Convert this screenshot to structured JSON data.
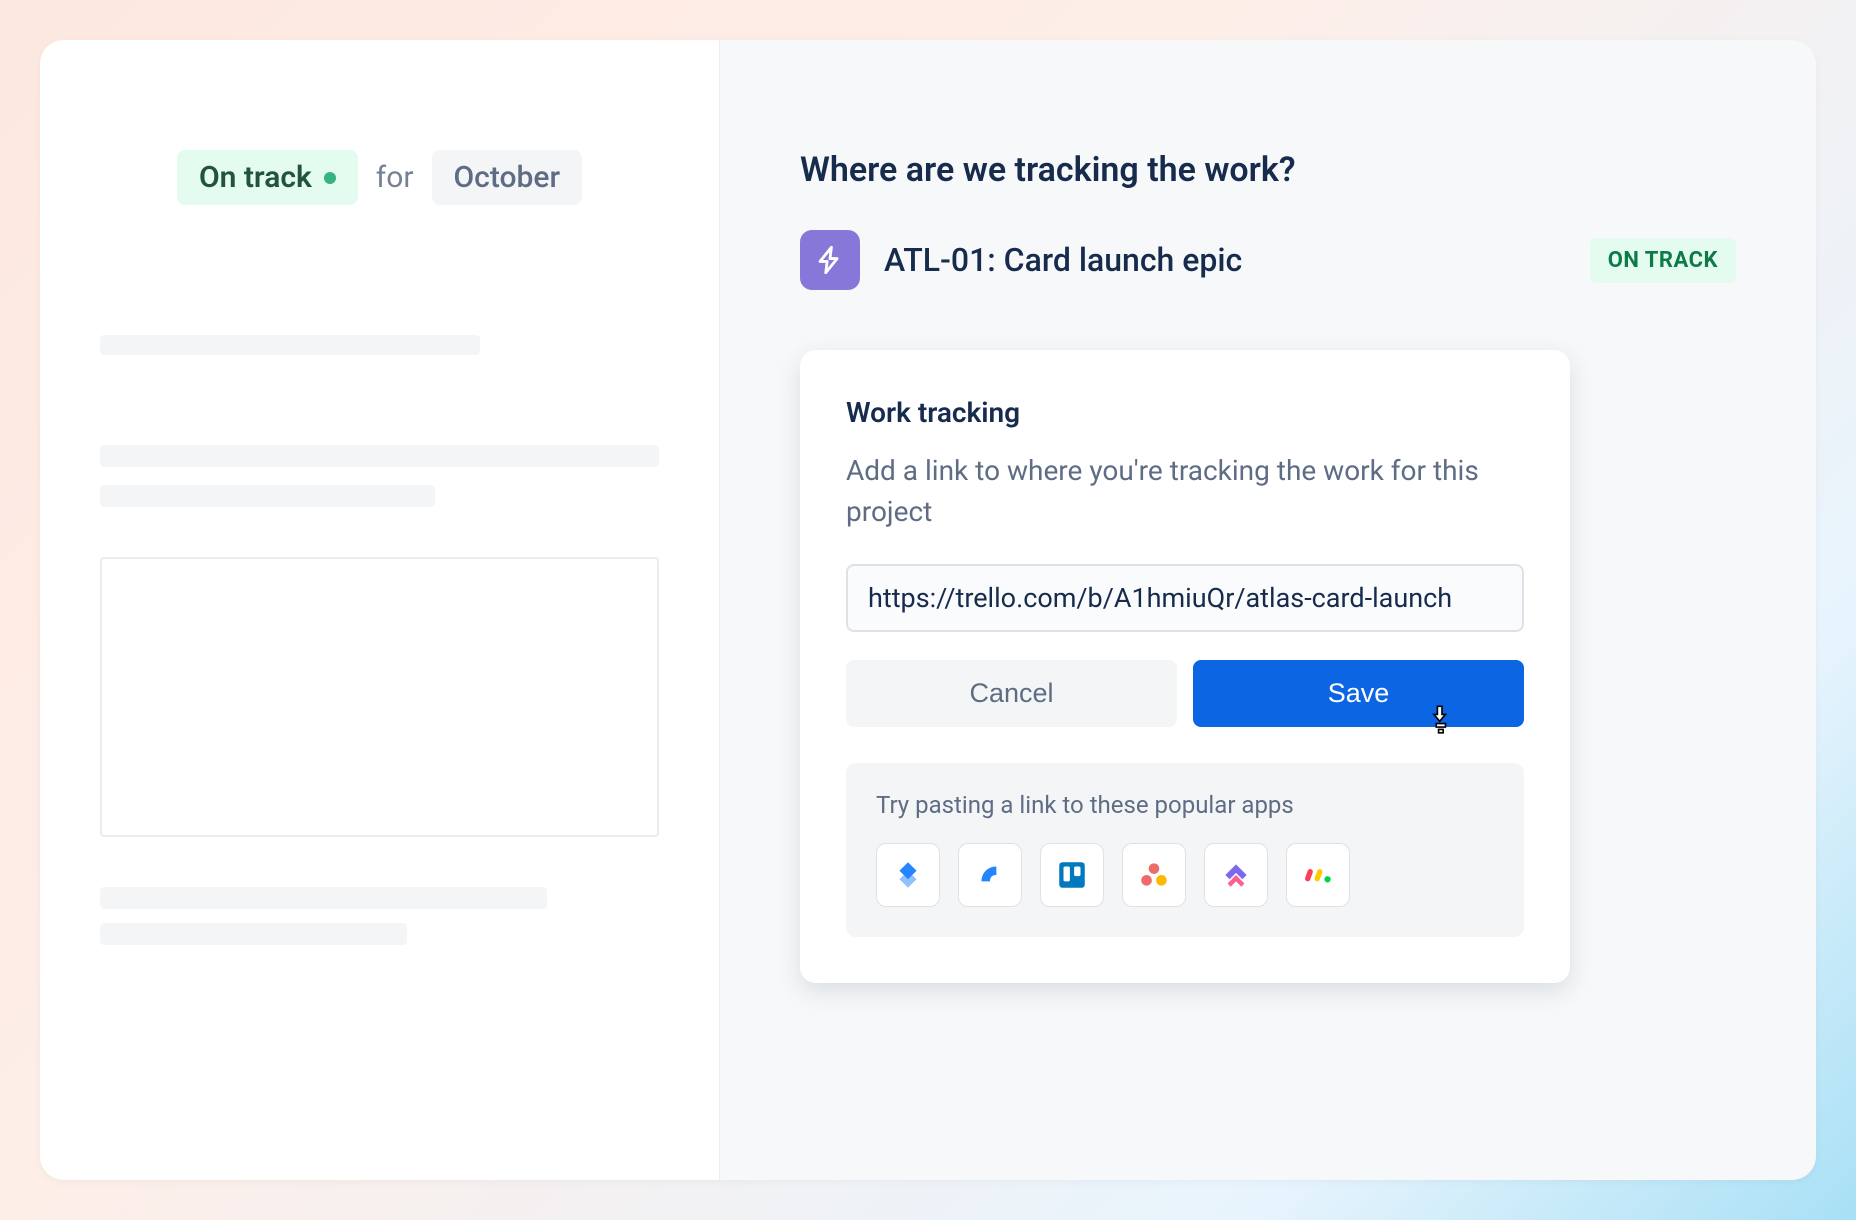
{
  "left": {
    "status_label": "On track",
    "for_label": "for",
    "month_label": "October"
  },
  "right": {
    "section_title": "Where are we tracking the work?",
    "epic": {
      "title": "ATL-01: Card launch epic",
      "status": "ON TRACK"
    },
    "card": {
      "title": "Work tracking",
      "description": "Add a link to where you're tracking the work for this project",
      "url_value": "https://trello.com/b/A1hmiuQr/atlas-card-launch",
      "cancel_label": "Cancel",
      "save_label": "Save",
      "apps_hint": "Try pasting a link to these popular apps",
      "apps": [
        "jira",
        "jira-product-discovery",
        "trello",
        "asana",
        "clickup",
        "monday"
      ]
    }
  }
}
